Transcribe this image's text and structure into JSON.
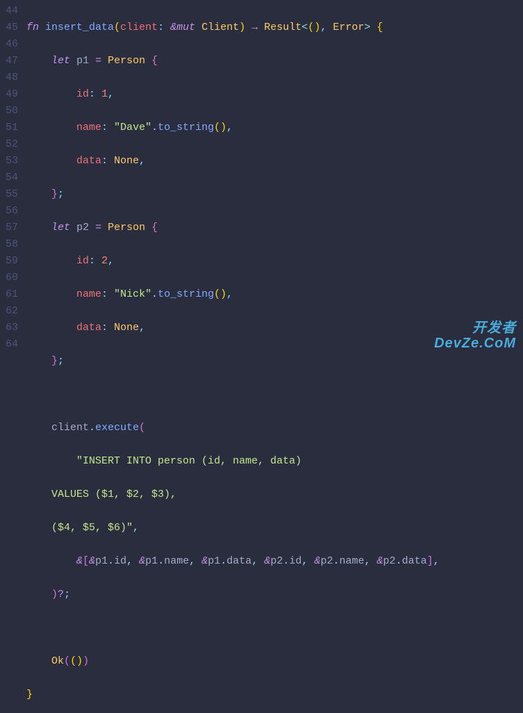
{
  "gutter": {
    "start": 44,
    "end": 64,
    "lines": [
      "44",
      "45",
      "46",
      "47",
      "48",
      "49",
      "50",
      "51",
      "52",
      "53",
      "54",
      "55",
      "56",
      "57",
      "58",
      "59",
      "60",
      "61",
      "62",
      "63",
      "64"
    ]
  },
  "code": {
    "l44": {
      "fn": "fn",
      "name": "insert_data",
      "lp": "(",
      "p": "client",
      "colon": ":",
      "amp": "&",
      "mut": "mut",
      "ty": "Client",
      "rp": ")",
      "arr": "→",
      "res": "Result",
      "lt": "<",
      "unit_l": "(",
      "unit_r": ")",
      "comma": ",",
      "err": "Error",
      "gt": ">",
      "lb": "{"
    },
    "l45": {
      "let": "let",
      "v": "p1",
      "eq": "=",
      "ty": "Person",
      "lb": "{"
    },
    "l46": {
      "f": "id",
      "c": ":",
      "n": "1",
      "cm": ","
    },
    "l47": {
      "f": "name",
      "c": ":",
      "s": "\"Dave\"",
      "dot": ".",
      "m": "to_string",
      "lp": "(",
      "rp": ")",
      "cm": ","
    },
    "l48": {
      "f": "data",
      "c": ":",
      "v": "None",
      "cm": ","
    },
    "l49": {
      "rb": "}",
      "sc": ";"
    },
    "l50": {
      "let": "let",
      "v": "p2",
      "eq": "=",
      "ty": "Person",
      "lb": "{"
    },
    "l51": {
      "f": "id",
      "c": ":",
      "n": "2",
      "cm": ","
    },
    "l52": {
      "f": "name",
      "c": ":",
      "s": "\"Nick\"",
      "dot": ".",
      "m": "to_string",
      "lp": "(",
      "rp": ")",
      "cm": ","
    },
    "l53": {
      "f": "data",
      "c": ":",
      "v": "None",
      "cm": ","
    },
    "l54": {
      "rb": "}",
      "sc": ";"
    },
    "l56": {
      "obj": "client",
      "dot": ".",
      "m": "execute",
      "lp": "("
    },
    "l57": {
      "s": "\"INSERT INTO person (id, name, data)"
    },
    "l58": {
      "s": "    VALUES ($1, $2, $3),"
    },
    "l59": {
      "s": "    ($4, $5, $6)\"",
      "cm": ","
    },
    "l60": {
      "amp": "&",
      "lb": "[",
      "a1": "&",
      "v1": "p1",
      "d1": ".",
      "f1": "id",
      "c1": ",",
      "a2": "&",
      "v2": "p1",
      "d2": ".",
      "f2": "name",
      "c2": ",",
      "a3": "&",
      "v3": "p1",
      "d3": ".",
      "f3": "data",
      "c3": ",",
      "a4": "&",
      "v4": "p2",
      "d4": ".",
      "f4": "id",
      "c4": ",",
      "a5": "&",
      "v5": "p2",
      "d5": ".",
      "f5": "name",
      "c5": ",",
      "a6": "&",
      "v6": "p2",
      "d6": ".",
      "f6": "data",
      "rb": "]",
      "cm": ","
    },
    "l61": {
      "rp": ")",
      "q": "?",
      "sc": ";"
    },
    "l63": {
      "ok": "Ok",
      "lp": "(",
      "lp2": "(",
      "rp2": ")",
      "rp": ")"
    },
    "l64": {
      "rb": "}"
    }
  },
  "watermark": {
    "line1": "开发者",
    "line2": "DevZe.CoM"
  }
}
